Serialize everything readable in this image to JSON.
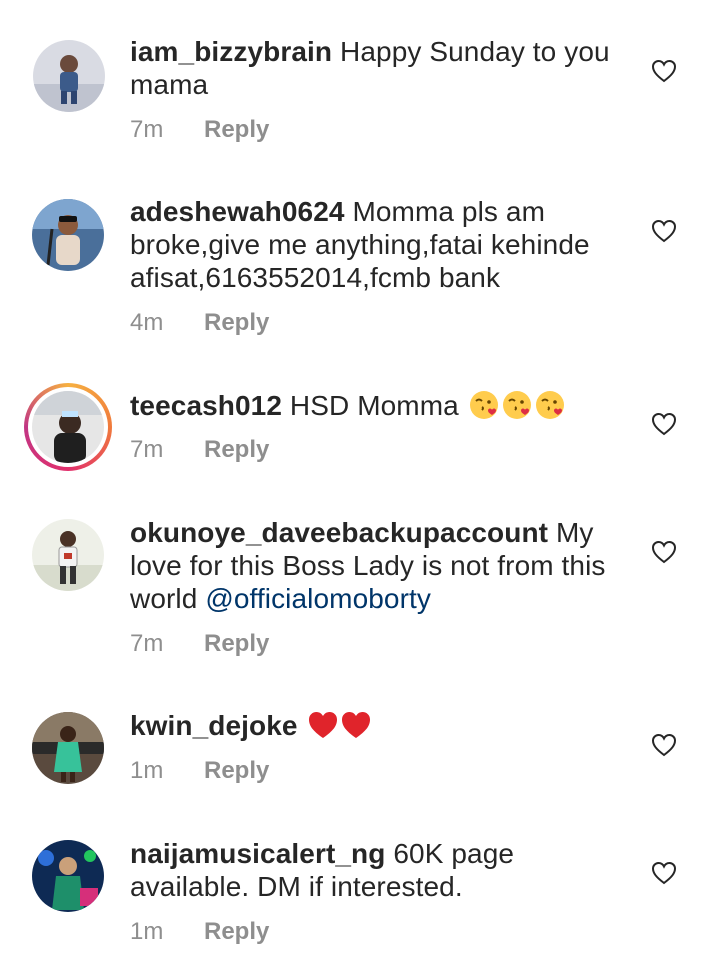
{
  "comments": [
    {
      "username": "iam_bizzybrain",
      "text": "Happy Sunday to you mama",
      "time": "7m",
      "reply": "Reply"
    },
    {
      "username": "adeshewah0624",
      "text": "Momma pls am broke,give me anything,fatai kehinde afisat,6163552014,fcmb bank",
      "time": "4m",
      "reply": "Reply"
    },
    {
      "username": "teecash012",
      "text": "HSD Momma",
      "emojis": [
        "face-blowing-kiss",
        "face-blowing-kiss",
        "face-blowing-kiss"
      ],
      "time": "7m",
      "reply": "Reply"
    },
    {
      "username": "okunoye_daveebackupaccount",
      "text": "My love for this Boss Lady is not from this world",
      "mention": "@officialomoborty",
      "time": "7m",
      "reply": "Reply"
    },
    {
      "username": "kwin_dejoke",
      "text": "",
      "emojis": [
        "red-heart",
        "red-heart"
      ],
      "time": "1m",
      "reply": "Reply"
    },
    {
      "username": "naijamusicalert_ng",
      "text": "60K page available. DM if interested.",
      "time": "1m",
      "reply": "Reply"
    }
  ],
  "icons": {
    "like": "heart-outline-icon"
  },
  "colors": {
    "mention": "#003569",
    "meta": "#8e8e8e",
    "text": "#262626",
    "heart": "#e0242b"
  }
}
